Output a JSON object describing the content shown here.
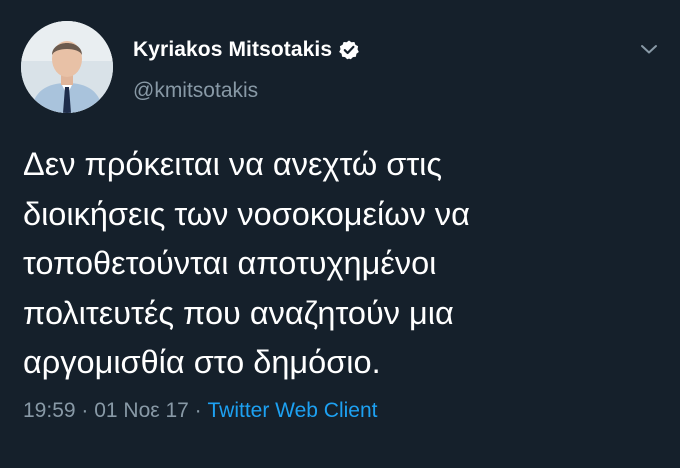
{
  "author": {
    "display_name": "Kyriakos Mitsotakis",
    "handle": "@kmitsotakis",
    "verified": true,
    "avatar_icon": "profile-photo"
  },
  "tweet": {
    "text": "Δεν πρόκειται να ανεχτώ στις\nδιοικήσεις των νοσοκομείων να\nτοποθετούνται αποτυχημένοι\nπολιτευτές που αναζητούν μια\nαργομισθία στο δημόσιο."
  },
  "meta": {
    "time": "19:59",
    "separator_1": " · ",
    "date": "01 Νοε 17",
    "separator_2": " · ",
    "source": "Twitter Web Client"
  },
  "colors": {
    "background": "#15202b",
    "primary_text": "#ffffff",
    "secondary_text": "#8899a6",
    "accent": "#1da1f2"
  },
  "icons": {
    "verified": "verified-badge-icon",
    "more": "chevron-down-icon"
  }
}
